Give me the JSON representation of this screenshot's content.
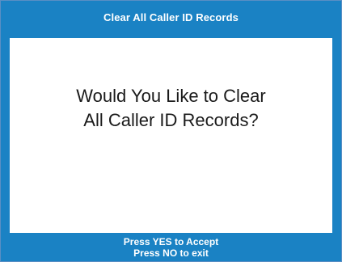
{
  "dialog": {
    "title": "Clear All Caller ID Records",
    "prompt_line1": "Would You Like to Clear",
    "prompt_line2": "All Caller ID Records?",
    "footer_line1": "Press YES to Accept",
    "footer_line2": "Press NO to exit"
  },
  "colors": {
    "frame": "#1a82c4",
    "content_background": "#ffffff",
    "text_on_frame": "#ffffff",
    "prompt_text": "#1a1a1a"
  }
}
